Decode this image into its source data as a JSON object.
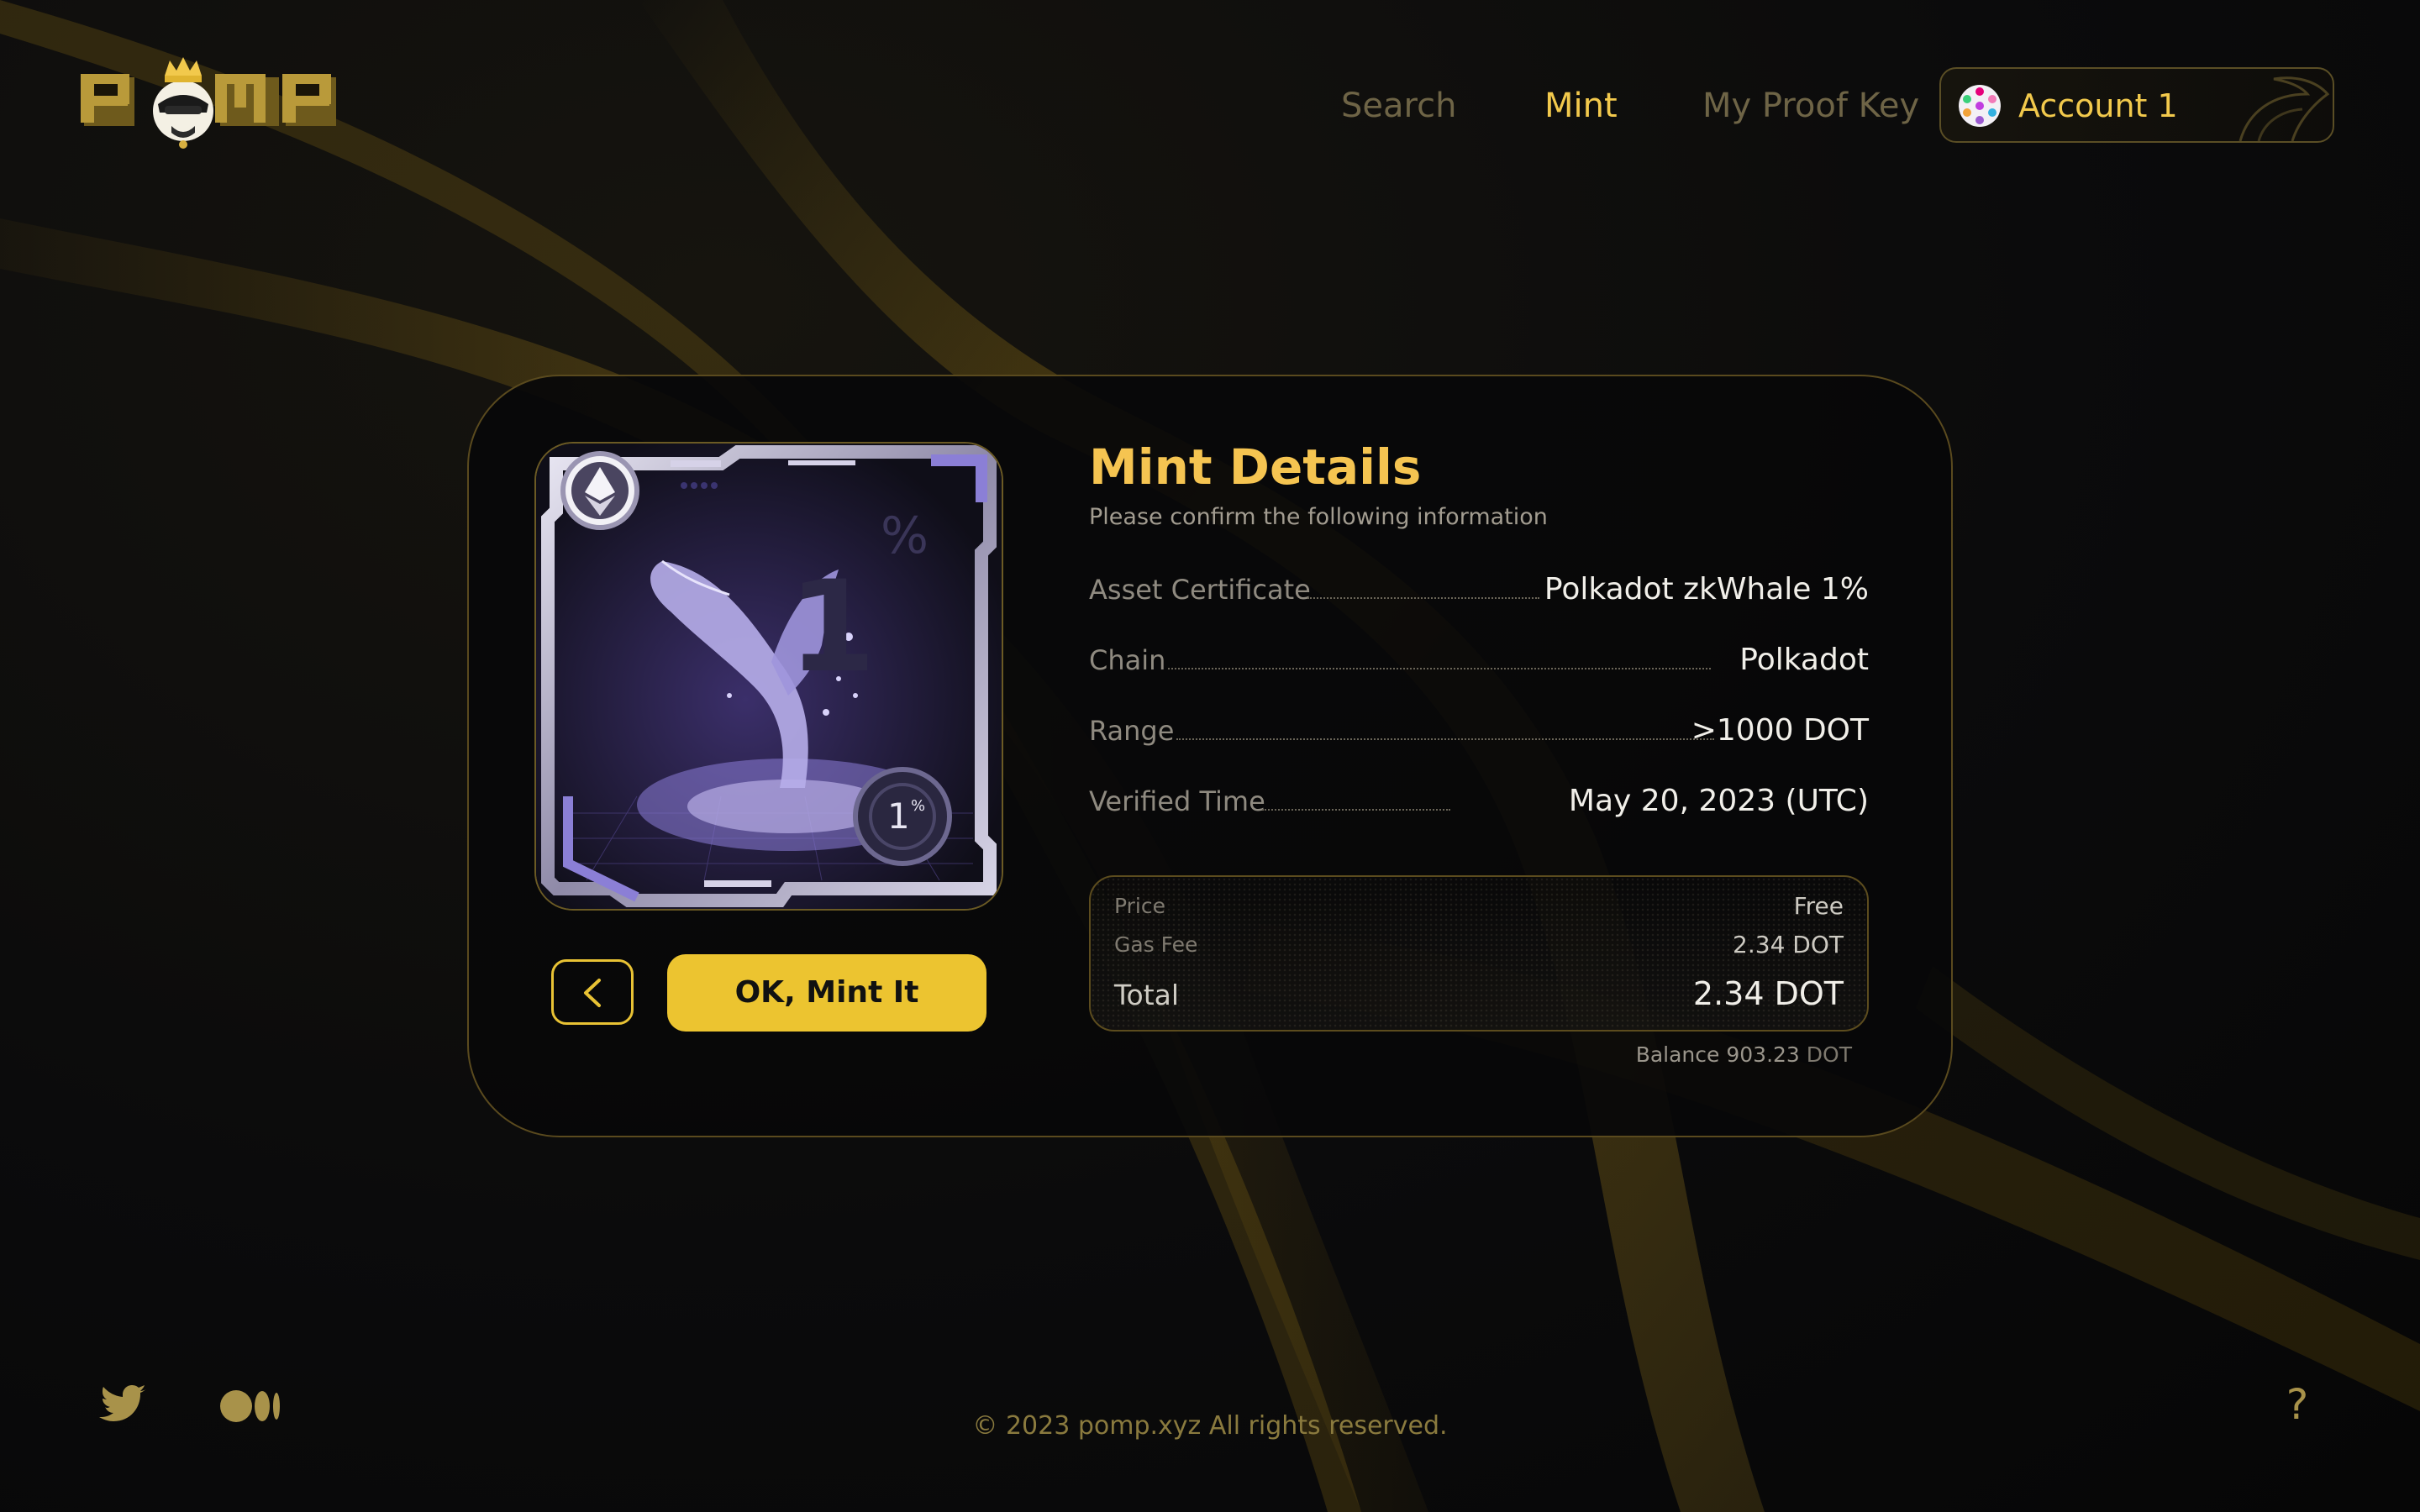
{
  "header": {
    "nav": {
      "search": "Search",
      "mint": "Mint",
      "proof_key": "My Proof Key"
    },
    "account": {
      "label": "Account 1"
    },
    "logo_text": "POMP"
  },
  "mint_details": {
    "title": "Mint Details",
    "subtitle": "Please confirm the following information",
    "rows": [
      {
        "label": "Asset Certificate",
        "value": "Polkadot zkWhale 1%"
      },
      {
        "label": "Chain",
        "value": "Polkadot"
      },
      {
        "label": "Range",
        "value": ">1000 DOT"
      },
      {
        "label": "Verified Time",
        "value": "May 20, 2023 (UTC)"
      }
    ],
    "fees": {
      "price_label": "Price",
      "price_value": "Free",
      "gas_label": "Gas Fee",
      "gas_value": "2.34 DOT",
      "total_label": "Total",
      "total_value": "2.34 DOT"
    },
    "balance": {
      "label": "Balance",
      "amount": "903.23",
      "unit": "DOT"
    }
  },
  "nft": {
    "badge_value": "1",
    "badge_unit": "%"
  },
  "actions": {
    "mint_label": "OK, Mint It"
  },
  "footer": {
    "copyright": "© 2023 pomp.xyz All rights reserved.",
    "help": "?"
  },
  "icons": {
    "back": "chevron-left-icon",
    "twitter": "twitter-icon",
    "medium": "medium-icon",
    "help": "help-icon",
    "chain": "ethereum-icon"
  },
  "colors": {
    "accent": "#f2c94c",
    "button": "#ecc430",
    "muted_nav": "#6e6446",
    "background": "#0b0b0c"
  }
}
